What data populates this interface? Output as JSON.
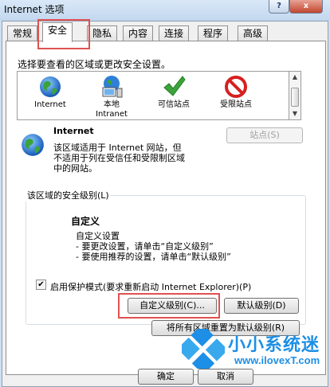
{
  "window": {
    "title": "Internet 选项",
    "help": "?",
    "close": "x"
  },
  "tabs": [
    "常规",
    "安全",
    "隐私",
    "内容",
    "连接",
    "程序",
    "高级"
  ],
  "zones": {
    "prompt": "选择要查看的区域或更改安全设置。",
    "items": [
      {
        "label": "Internet",
        "icon": "internet-globe-icon"
      },
      {
        "label": "本地\nIntranet",
        "icon": "intranet-computer-icon"
      },
      {
        "label": "可信站点",
        "icon": "checkmark-icon"
      },
      {
        "label": "受限站点",
        "icon": "restricted-no-icon"
      }
    ]
  },
  "zone_detail": {
    "name": "Internet",
    "description": [
      "该区域适用于 Internet 网站，但",
      "不适用于列在受信任和受限制区域",
      "中的网站。"
    ],
    "sites_button": "站点(S)"
  },
  "security_level": {
    "group_title": "该区域的安全级别(L)",
    "level_name": "自定义",
    "lines": [
      "自定义设置",
      "- 要更改设置，请单击“自定义级别”",
      "- 要使用推荐的设置，请单击“默认级别”"
    ],
    "protected_mode_label": "启用保护模式(要求重新启动 Internet Explorer)(P)",
    "protected_mode_checked": true,
    "custom_button": "自定义级别(C)...",
    "default_button": "默认级别(D)"
  },
  "reset_all_button": "将所有区域重置为默认级别(R)",
  "footer": {
    "ok": "确定",
    "cancel": "取消"
  },
  "watermark": {
    "brand": "小小系统迷",
    "url": "www.ilovexT.com"
  },
  "colors": {
    "highlight_box": "#e05151",
    "check_green": "#3aa43a",
    "restricted_red": "#d62020",
    "watermark_blue": "#1d8fe6"
  }
}
